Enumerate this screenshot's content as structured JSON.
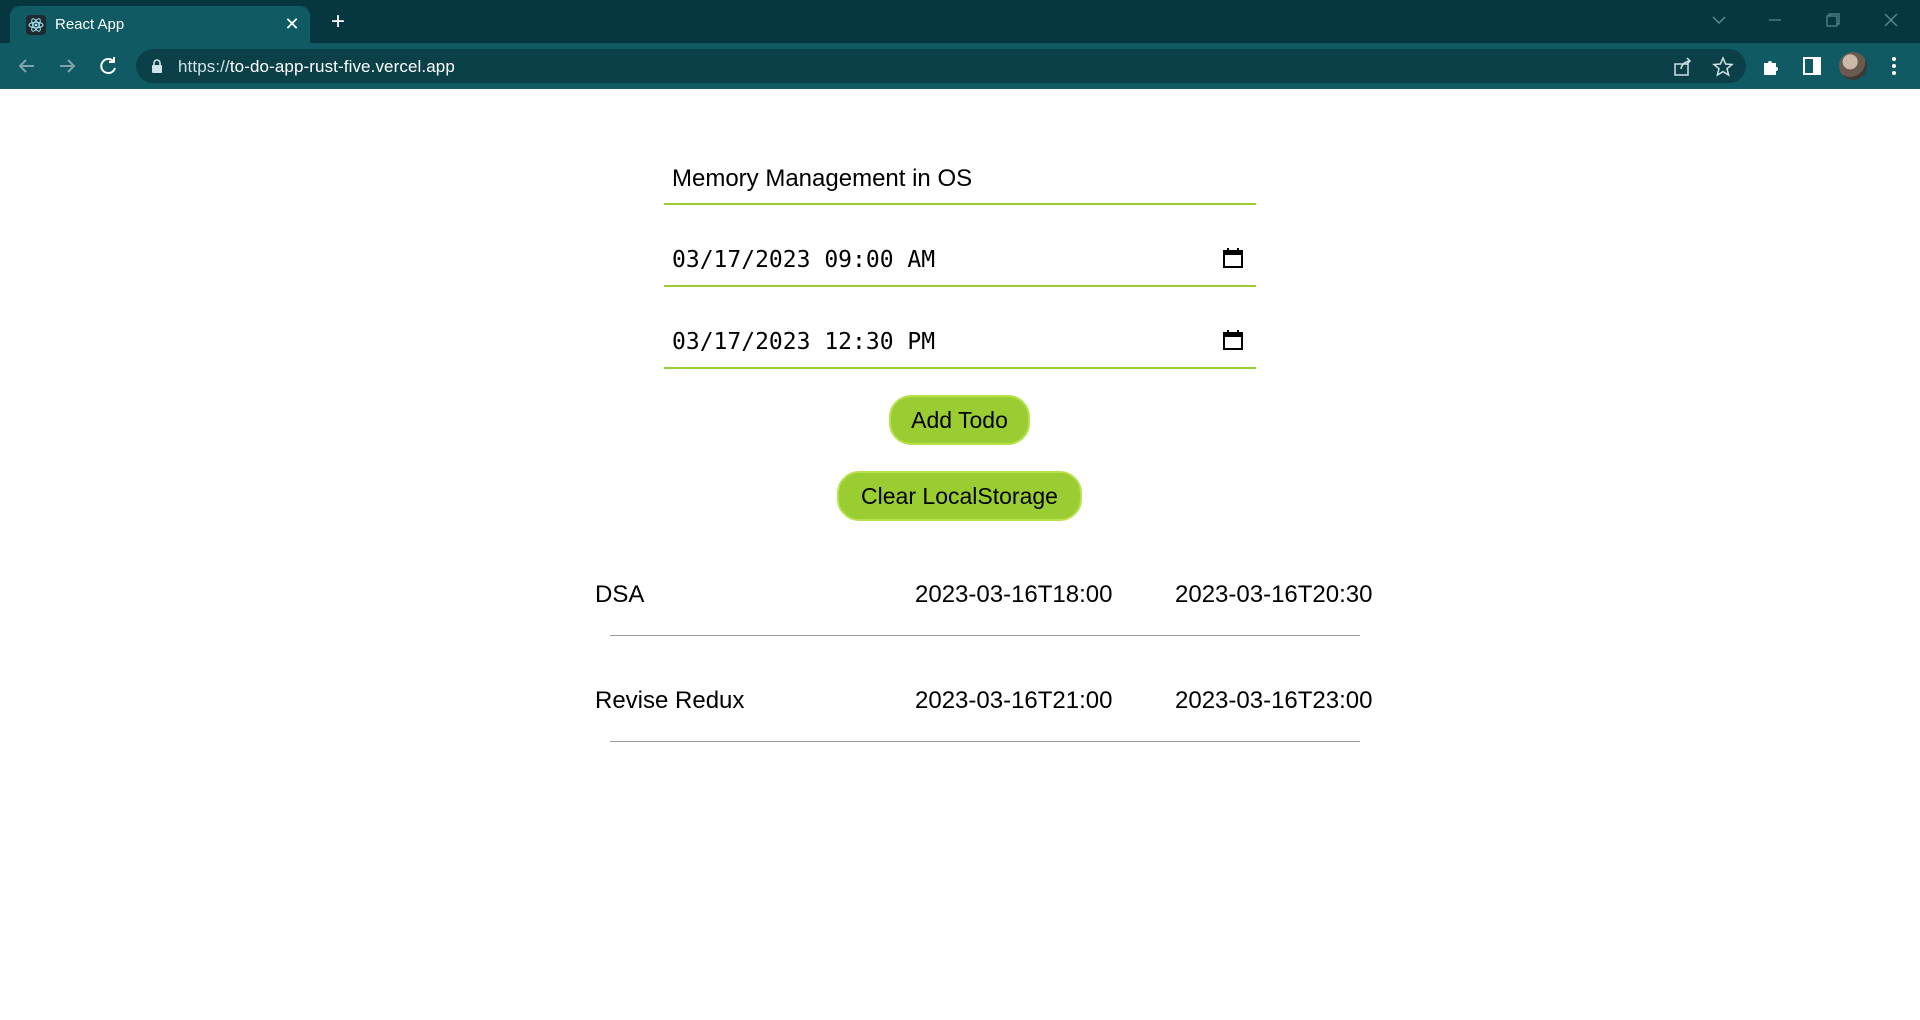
{
  "browser": {
    "tab_title": "React App",
    "tab_close_icon": "close-icon",
    "new_tab_icon": "plus-icon",
    "url_scheme": "https://",
    "url_host": "to-do-app-rust-five.vercel.app"
  },
  "form": {
    "title_value": "Memory Management in OS",
    "start_value": "03/17/2023 09:00 AM",
    "end_value": "03/17/2023 12:30 PM",
    "add_label": "Add Todo",
    "clear_label": "Clear LocalStorage"
  },
  "todos": [
    {
      "title": "DSA",
      "start": "2023-03-16T18:00",
      "end": "2023-03-16T20:30"
    },
    {
      "title": "Revise Redux",
      "start": "2023-03-16T21:00",
      "end": "2023-03-16T23:00"
    }
  ],
  "colors": {
    "accent": "#9acd32",
    "tabstrip": "#06363f",
    "toolbar": "#0f5a63"
  }
}
